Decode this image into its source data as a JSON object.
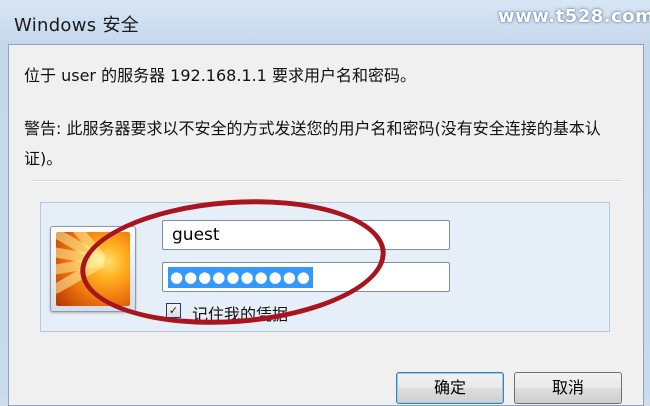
{
  "window": {
    "title": "Windows 安全",
    "watermark": "www.t528.com"
  },
  "dialog": {
    "prompt": "位于 user 的服务器 192.168.1.1 要求用户名和密码。",
    "warning": "警告: 此服务器要求以不安全的方式发送您的用户名和密码(没有安全连接的基本认证)。"
  },
  "credentials": {
    "username": "guest",
    "password_mask": "●●●●●●●●●●",
    "remember_label": "记住我的凭据",
    "remember_checked": true
  },
  "buttons": {
    "ok": "确定",
    "cancel": "取消"
  },
  "colors": {
    "annotation_ellipse": "#a8151e",
    "selection": "#3399ff"
  },
  "icons": {
    "user_tile": "user-flower-icon",
    "checkbox": "checkbox-checked-icon"
  }
}
